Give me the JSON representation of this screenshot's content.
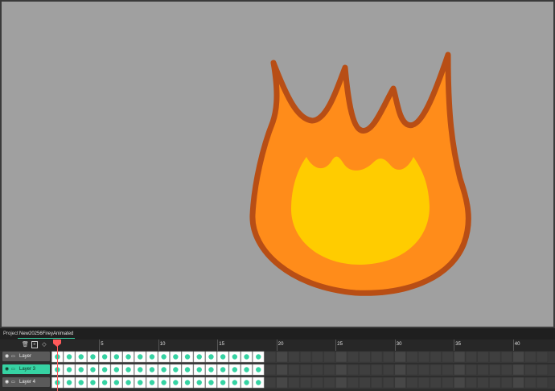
{
  "tabs": {
    "project": "Project",
    "file": "New20256FireyAnimated"
  },
  "layers": [
    {
      "name": "Layer",
      "active": false
    },
    {
      "name": "Layer 3",
      "active": true
    },
    {
      "name": "Layer 4",
      "active": false
    }
  ],
  "ruler": {
    "labels": [
      "5",
      "10",
      "15",
      "20",
      "25",
      "30",
      "35",
      "40"
    ],
    "label_frames": [
      5,
      10,
      15,
      20,
      25,
      30,
      35,
      40
    ]
  },
  "frames": {
    "filled_count": 18,
    "current_frame": 1
  },
  "colors": {
    "accent": "#36d3a3",
    "stage_bg": "#a0a0a0",
    "fire_outline": "#b84e15",
    "fire_body": "#ff8c1a",
    "fire_core": "#ffcc00",
    "keyframe": "#36d3a3",
    "playhead": "#ff5a5a"
  },
  "icons": {
    "delete": "trash-icon",
    "duplicate": "file-icon",
    "keyframe": "diamond-icon",
    "eye": "eye-icon",
    "lock": "lock-icon"
  }
}
